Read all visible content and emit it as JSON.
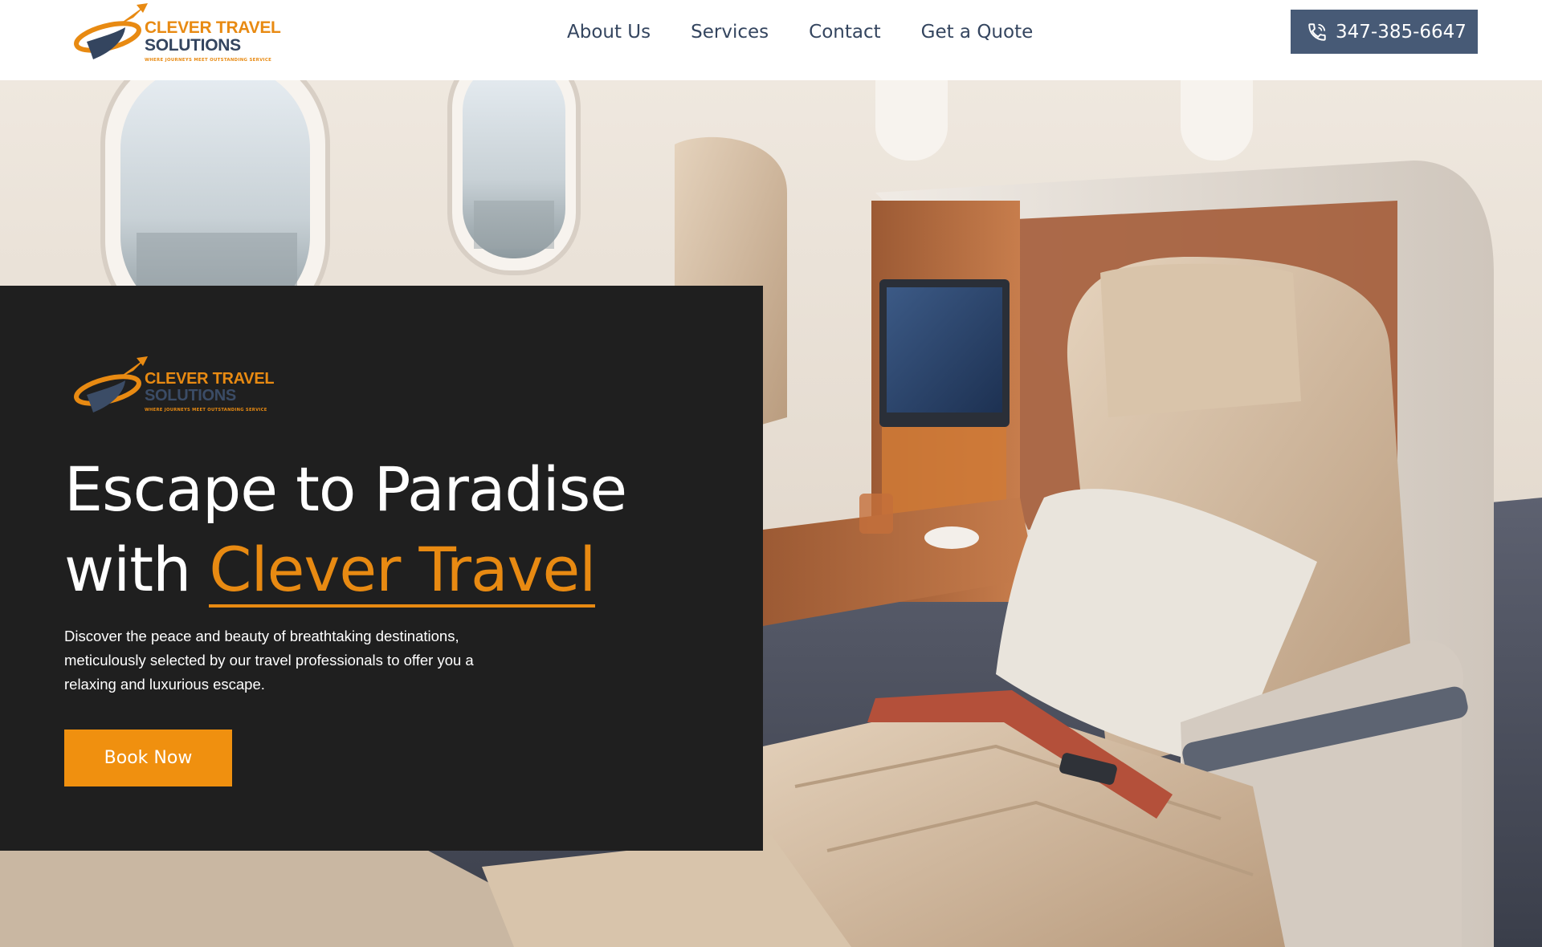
{
  "brand": {
    "name_line1": "CLEVER TRAVEL",
    "name_line2": "SOLUTIONS",
    "tagline": "WHERE JOURNEYS MEET OUTSTANDING SERVICE"
  },
  "nav": {
    "items": [
      {
        "label": "About Us"
      },
      {
        "label": "Services"
      },
      {
        "label": "Contact"
      },
      {
        "label": "Get a Quote"
      }
    ]
  },
  "header": {
    "phone": "347-385-6647",
    "phone_icon": "phone-icon"
  },
  "hero": {
    "headline_part1": "Escape to Paradise",
    "headline_part2": "with ",
    "headline_accent": "Clever Travel",
    "description": "Discover the peace and beauty of breathtaking destinations, meticulously selected by our travel professionals to offer you a relaxing and luxurious escape.",
    "cta_label": "Book Now"
  },
  "colors": {
    "accent": "#e88a12",
    "navy": "#34455f",
    "panel": "#1f1f1f",
    "phone_button": "#475a76"
  }
}
